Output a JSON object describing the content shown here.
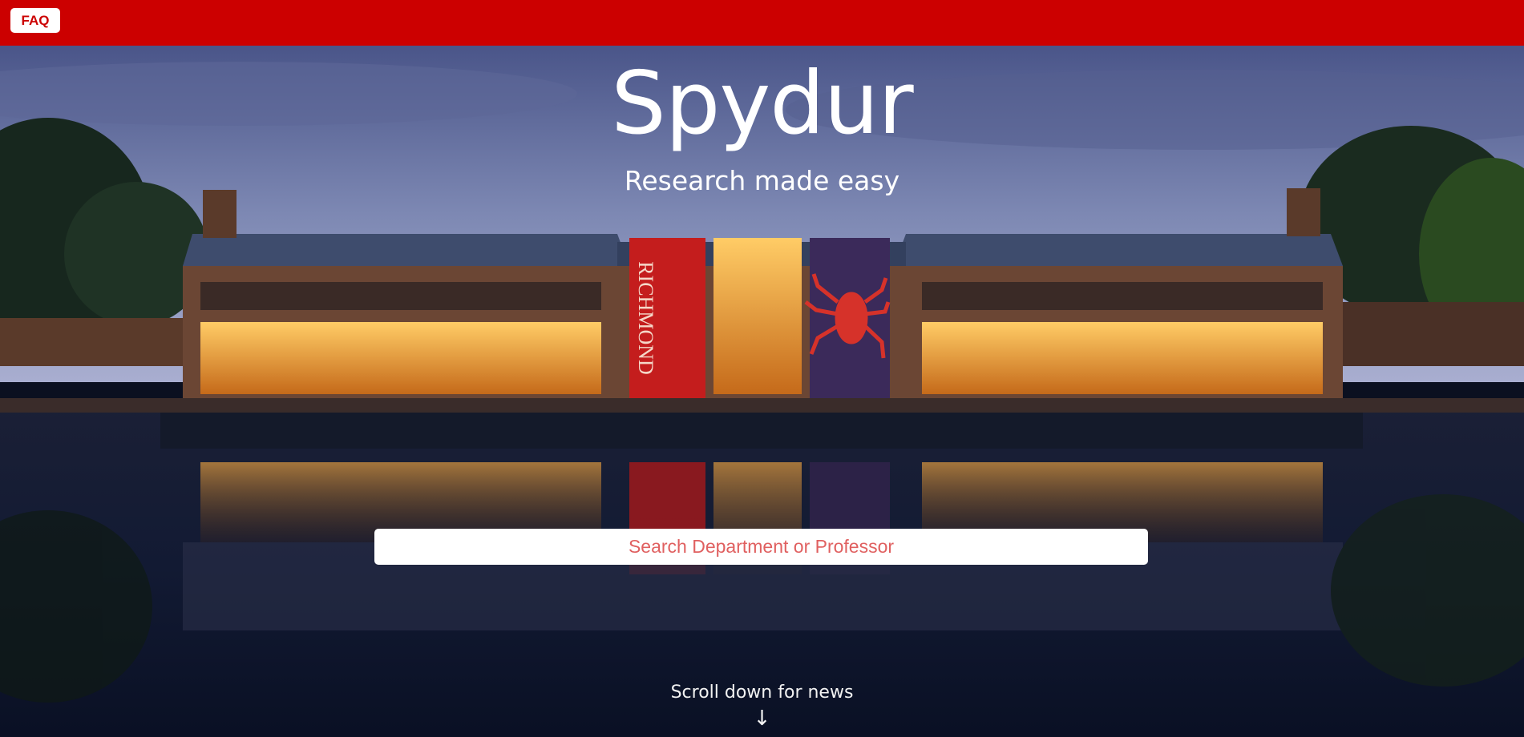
{
  "header": {
    "faq_label": "FAQ",
    "bar_color": "#cc0000"
  },
  "hero": {
    "title": "Spydur",
    "subtitle": "Research made easy",
    "background": "night-campus-building-reflection-photo",
    "banner_text": "RICHMOND"
  },
  "search": {
    "placeholder": "Search Department or Professor",
    "value": ""
  },
  "footer_hint": {
    "text": "Scroll down for news",
    "arrow": "↓"
  },
  "colors": {
    "accent": "#cc0000",
    "placeholder": "#e06060",
    "sky_top": "#3f4f86",
    "water": "#0d1428"
  }
}
